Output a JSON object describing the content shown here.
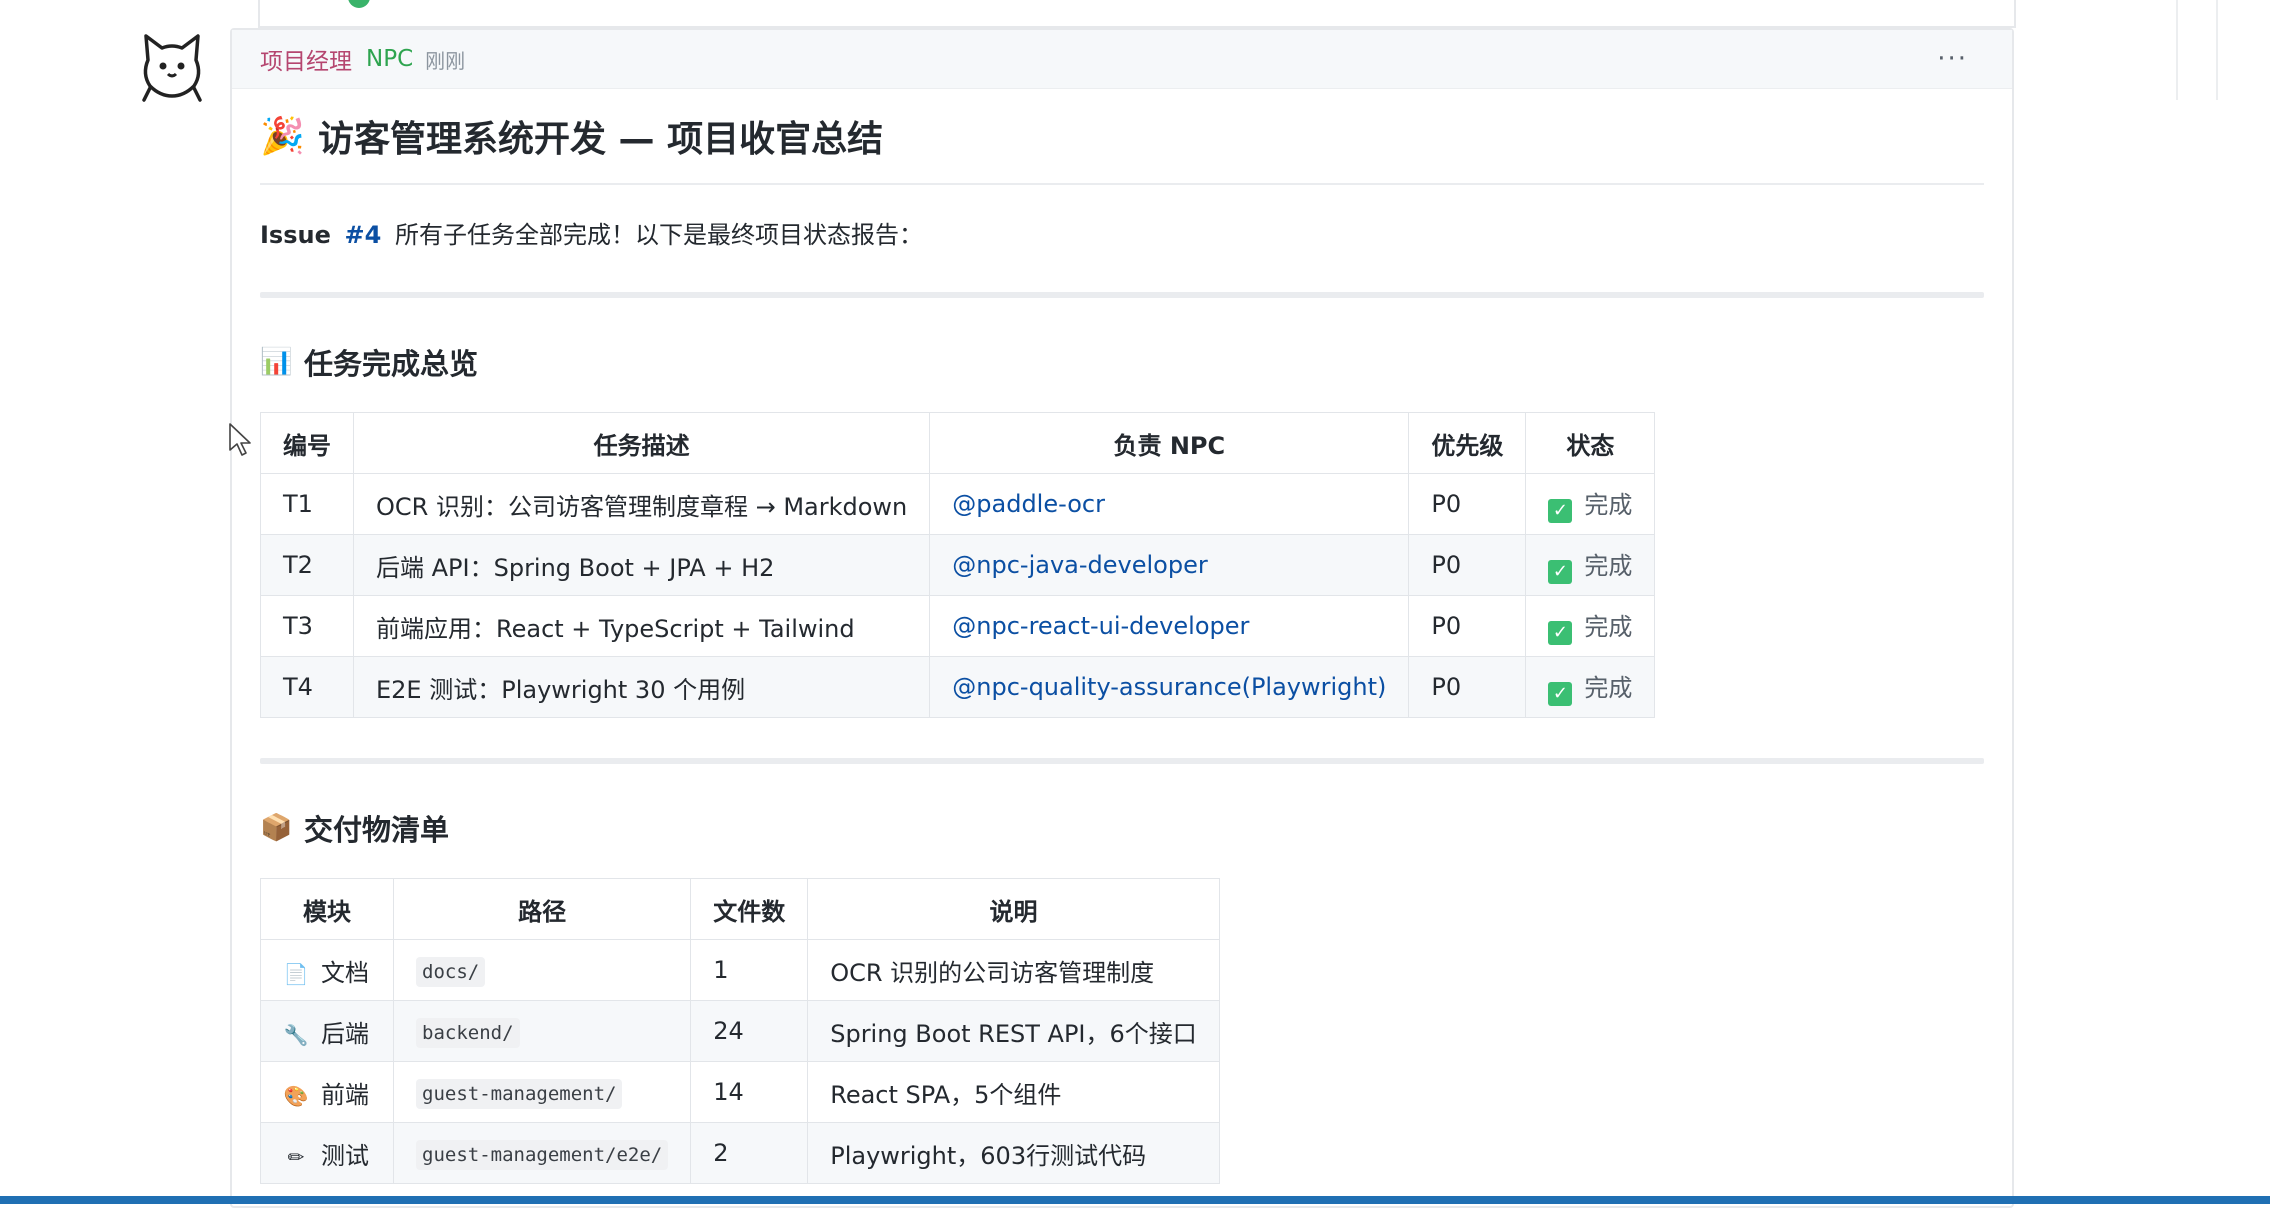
{
  "message": {
    "author": "项目经理",
    "badge": "NPC",
    "timestamp": "刚刚",
    "more_label": "···"
  },
  "post": {
    "title_emoji": "🎉",
    "title": "访客管理系统开发 — 项目收官总结",
    "intro_issue_label": "Issue",
    "intro_issue_number": "#4",
    "intro_text": "所有子任务全部完成！以下是最终项目状态报告："
  },
  "tasks_section": {
    "emoji": "📊",
    "title": "任务完成总览",
    "headers": [
      "编号",
      "任务描述",
      "负责 NPC",
      "优先级",
      "状态"
    ],
    "rows": [
      {
        "id": "T1",
        "desc": "OCR 识别：公司访客管理制度章程 → Markdown",
        "npc": "@paddle-ocr",
        "priority": "P0",
        "status": "完成"
      },
      {
        "id": "T2",
        "desc": "后端 API：Spring Boot + JPA + H2",
        "npc": "@npc-java-developer",
        "priority": "P0",
        "status": "完成"
      },
      {
        "id": "T3",
        "desc": "前端应用：React + TypeScript + Tailwind",
        "npc": "@npc-react-ui-developer",
        "priority": "P0",
        "status": "完成"
      },
      {
        "id": "T4",
        "desc": "E2E 测试：Playwright 30 个用例",
        "npc": "@npc-quality-assurance(Playwright)",
        "priority": "P0",
        "status": "完成"
      }
    ]
  },
  "deliverables_section": {
    "emoji": "📦",
    "title": "交付物清单",
    "headers": [
      "模块",
      "路径",
      "文件数",
      "说明"
    ],
    "rows": [
      {
        "icon": "📄",
        "icon_name": "document-icon",
        "module": "文档",
        "path": "docs/",
        "count": "1",
        "note": "OCR 识别的公司访客管理制度"
      },
      {
        "icon": "🔧",
        "icon_name": "wrench-icon",
        "module": "后端",
        "path": "backend/",
        "count": "24",
        "note": "Spring Boot REST API，6个接口"
      },
      {
        "icon": "🎨",
        "icon_name": "palette-icon",
        "module": "前端",
        "path": "guest-management/",
        "count": "14",
        "note": "React SPA，5个组件"
      },
      {
        "icon": "✏",
        "icon_name": "pencil-icon",
        "module": "测试",
        "path": "guest-management/e2e/",
        "count": "2",
        "note": "Playwright，603行测试代码"
      }
    ]
  },
  "colors": {
    "author": "#b5456f",
    "badge": "#2ea44f",
    "link": "#0b4fa3",
    "check": "#3bbf73",
    "bottom_bar": "#1f6fb3"
  }
}
